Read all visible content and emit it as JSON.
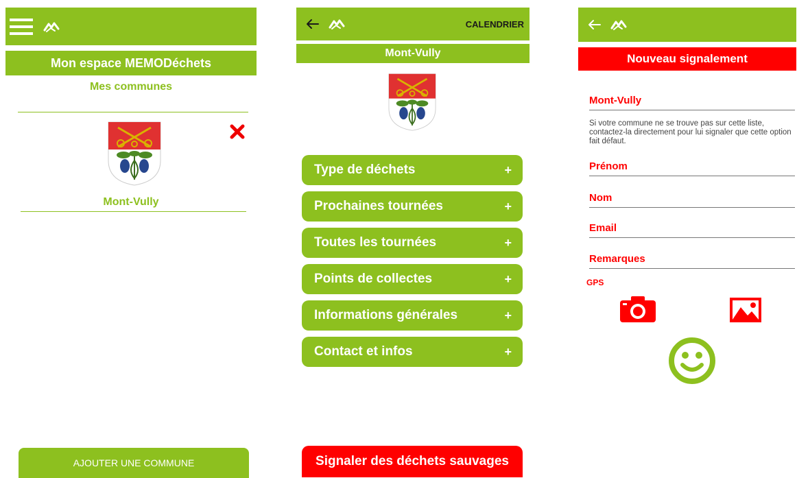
{
  "screen1": {
    "header_title": "Mon espace MEMODéchets",
    "section_title": "Mes communes",
    "commune_name": "Mont-Vully",
    "add_button": "AJOUTER UNE COMMUNE"
  },
  "screen2": {
    "calendar_label": "CALENDRIER",
    "title": "Mont-Vully",
    "menu": [
      {
        "label": "Type de déchets"
      },
      {
        "label": "Prochaines tournées"
      },
      {
        "label": "Toutes les tournées"
      },
      {
        "label": "Points de collectes"
      },
      {
        "label": "Informations générales"
      },
      {
        "label": "Contact et infos"
      }
    ],
    "expand_symbol": "+",
    "report_button": "Signaler des déchets sauvages"
  },
  "screen3": {
    "title": "Nouveau signalement",
    "commune_select": "Mont-Vully",
    "help_text": "Si votre commune ne se trouve pas sur cette liste, contactez-la directement pour lui signaler que cette option fait défaut.",
    "fields": {
      "prenom": "Prénom",
      "nom": "Nom",
      "email": "Email",
      "remarques": "Remarques"
    },
    "gps_label": "GPS"
  },
  "colors": {
    "green": "#8dc01f",
    "red": "#ff0000",
    "crest_red": "#e03131",
    "grape_blue": "#27478e"
  },
  "icons": [
    "menu-icon",
    "app-logo-icon",
    "back-arrow-icon",
    "delete-icon",
    "camera-icon",
    "gallery-icon",
    "smiley-icon",
    "coat-of-arms"
  ]
}
